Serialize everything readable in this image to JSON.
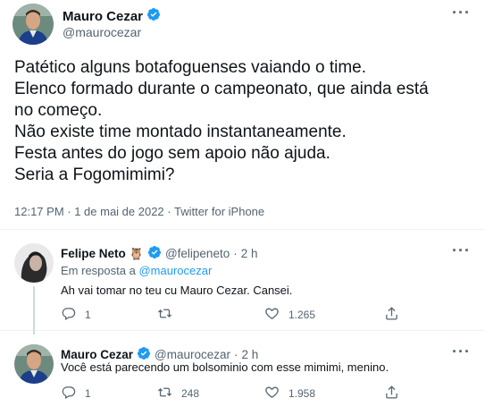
{
  "main_tweet": {
    "author_name": "Mauro Cezar",
    "author_handle": "@maurocezar",
    "more_label": "···",
    "text_lines": [
      "Patético alguns botafoguenses vaiando o time.",
      "Elenco formado durante o campeonato, que ainda está",
      "no começo.",
      "Não existe time montado instantaneamente.",
      "Festa antes do jogo sem apoio não ajuda.",
      "Seria a Fogomimimi?"
    ],
    "meta": "12:17 PM · 1 de mai de 2022 · Twitter for iPhone"
  },
  "replies": [
    {
      "author_name": "Felipe Neto",
      "emoji": "🦉",
      "author_handle": "@felipeneto",
      "separator": "·",
      "time": "2 h",
      "in_reply_prefix": "Em resposta a",
      "in_reply_mention": "@maurocezar",
      "text": "Ah vai tomar no teu cu Mauro Cezar. Cansei.",
      "reply_count": "1",
      "retweet_count": "",
      "like_count": "1.265"
    },
    {
      "author_name": "Mauro Cezar",
      "author_handle": "@maurocezar",
      "separator": "·",
      "time": "2 h",
      "text": "Você está parecendo um bolsominio com esse mimimi, menino.",
      "reply_count": "1",
      "retweet_count": "248",
      "like_count": "1.958"
    }
  ],
  "colors": {
    "verified_blue": "#1d9bf0",
    "secondary_text": "#536471",
    "primary_text": "#0f1419",
    "divider": "#eff3f4"
  },
  "icons": [
    "verified-badge-icon",
    "more-options-icon",
    "reply-icon",
    "retweet-icon",
    "like-icon",
    "share-icon"
  ]
}
